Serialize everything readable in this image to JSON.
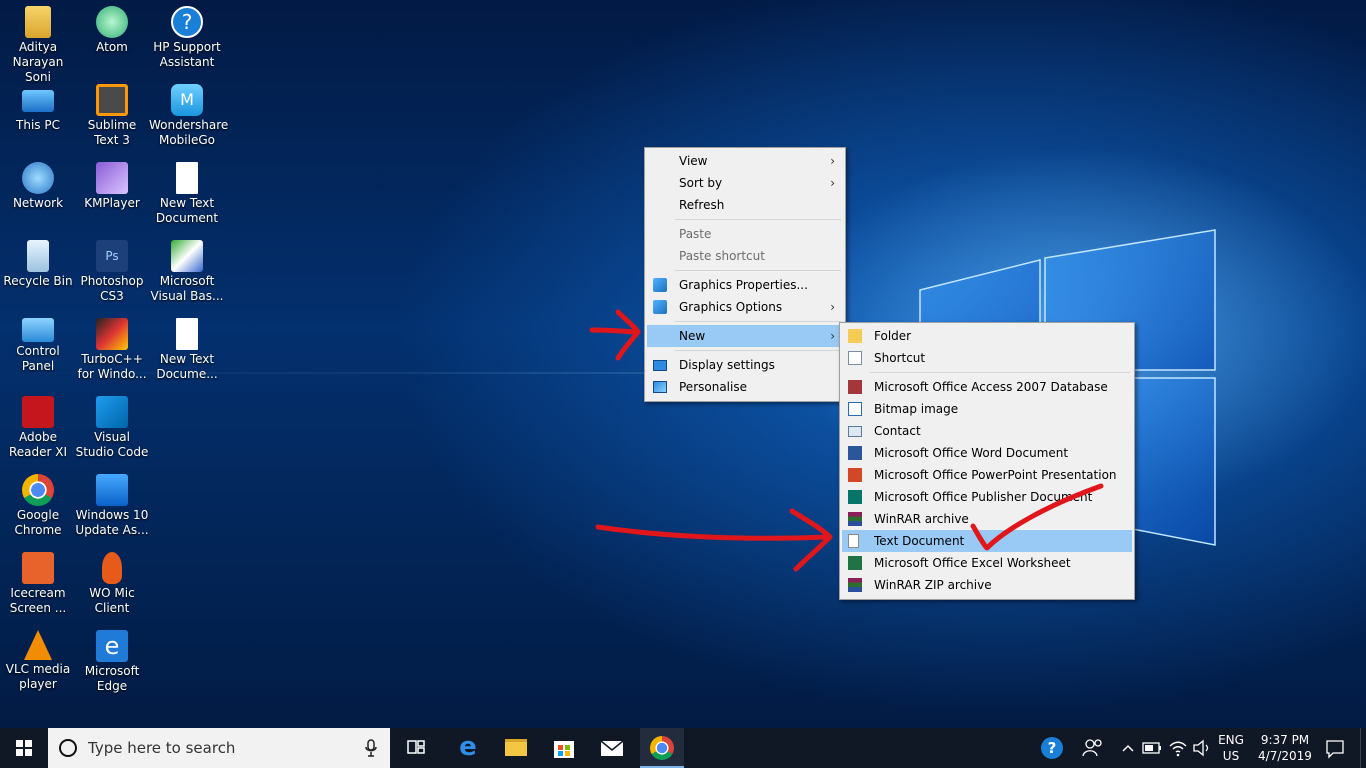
{
  "desktop_icons": [
    {
      "label": "Aditya Narayan Soni",
      "icon": "user-folder-icon"
    },
    {
      "label": "This PC",
      "icon": "computer-icon"
    },
    {
      "label": "Network",
      "icon": "network-icon"
    },
    {
      "label": "Recycle Bin",
      "icon": "recycle-bin-icon"
    },
    {
      "label": "Control Panel",
      "icon": "control-panel-icon"
    },
    {
      "label": "Adobe Reader XI",
      "icon": "adobe-reader-icon"
    },
    {
      "label": "Google Chrome",
      "icon": "chrome-icon"
    },
    {
      "label": "Icecream Screen ...",
      "icon": "icecream-icon"
    },
    {
      "label": "VLC media player",
      "icon": "vlc-icon"
    },
    {
      "label": "Atom",
      "icon": "atom-icon"
    },
    {
      "label": "Sublime Text 3",
      "icon": "sublime-icon"
    },
    {
      "label": "KMPlayer",
      "icon": "kmplayer-icon"
    },
    {
      "label": "Photoshop CS3",
      "icon": "photoshop-icon"
    },
    {
      "label": "TurboC++ for Windo...",
      "icon": "turboc-icon"
    },
    {
      "label": "Visual Studio Code",
      "icon": "vscode-icon"
    },
    {
      "label": "Windows 10 Update As...",
      "icon": "windows-update-icon"
    },
    {
      "label": "WO Mic Client",
      "icon": "microphone-icon"
    },
    {
      "label": "Microsoft Edge",
      "icon": "edge-icon"
    },
    {
      "label": "HP Support Assistant",
      "icon": "help-icon"
    },
    {
      "label": "Wondershare MobileGo",
      "icon": "mobilego-icon"
    },
    {
      "label": "New Text Document",
      "icon": "text-document-icon"
    },
    {
      "label": "Microsoft Visual Bas...",
      "icon": "visual-basic-icon"
    },
    {
      "label": "New Text Docume...",
      "icon": "text-document-icon"
    }
  ],
  "context_menu": {
    "items": [
      {
        "label": "View",
        "submenu": true
      },
      {
        "label": "Sort by",
        "submenu": true
      },
      {
        "label": "Refresh"
      },
      {
        "label": "Paste",
        "disabled": true
      },
      {
        "label": "Paste shortcut",
        "disabled": true
      },
      {
        "label": "Graphics Properties..."
      },
      {
        "label": "Graphics Options",
        "submenu": true
      },
      {
        "label": "New",
        "submenu": true,
        "highlighted": true
      },
      {
        "label": "Display settings"
      },
      {
        "label": "Personalise"
      }
    ]
  },
  "new_submenu": {
    "items": [
      {
        "label": "Folder",
        "icon": "folder-icon"
      },
      {
        "label": "Shortcut",
        "icon": "shortcut-icon"
      },
      {
        "label": "Microsoft Office Access 2007 Database",
        "icon": "access-icon"
      },
      {
        "label": "Bitmap image",
        "icon": "bitmap-icon"
      },
      {
        "label": "Contact",
        "icon": "contact-icon"
      },
      {
        "label": "Microsoft Office Word Document",
        "icon": "word-icon"
      },
      {
        "label": "Microsoft Office PowerPoint Presentation",
        "icon": "powerpoint-icon"
      },
      {
        "label": "Microsoft Office Publisher Document",
        "icon": "publisher-icon"
      },
      {
        "label": "WinRAR archive",
        "icon": "winrar-icon"
      },
      {
        "label": "Text Document",
        "icon": "text-document-icon",
        "highlighted": true
      },
      {
        "label": "Microsoft Office Excel Worksheet",
        "icon": "excel-icon"
      },
      {
        "label": "WinRAR ZIP archive",
        "icon": "winrar-zip-icon"
      }
    ]
  },
  "taskbar": {
    "search_placeholder": "Type here to search",
    "pinned": [
      "task-view-icon",
      "edge-icon",
      "file-explorer-icon",
      "store-icon",
      "mail-icon",
      "chrome-icon"
    ],
    "tray": {
      "language": "ENG",
      "region": "US",
      "time": "9:37 PM",
      "date": "4/7/2019"
    }
  },
  "colors": {
    "menu_highlight": "#99c9f5",
    "annotation_red": "#e0161b",
    "taskbar": "#101826"
  }
}
